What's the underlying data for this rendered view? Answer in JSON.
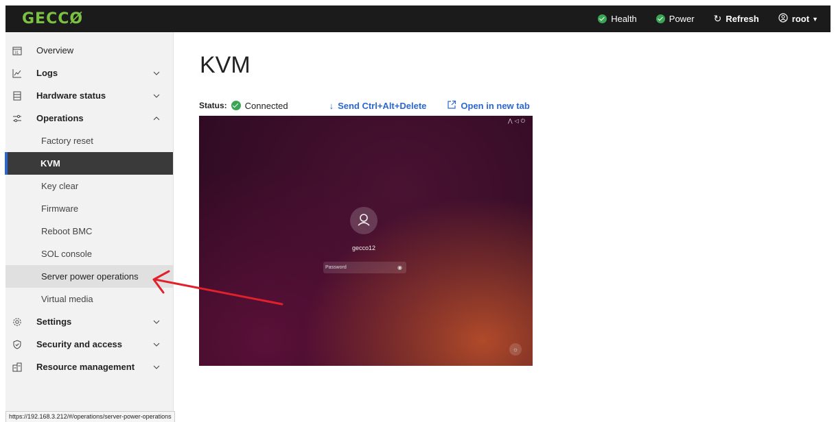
{
  "brand": {
    "logo_text": "GECCØ",
    "accent": "#7cc242"
  },
  "topbar": {
    "health_label": "Health",
    "power_label": "Power",
    "refresh_label": "Refresh",
    "user_label": "root",
    "status_color": "#3aa655"
  },
  "sidebar": {
    "overview": "Overview",
    "logs": "Logs",
    "hardware_status": "Hardware status",
    "operations": "Operations",
    "sub": {
      "factory_reset": "Factory reset",
      "kvm": "KVM",
      "key_clear": "Key clear",
      "firmware": "Firmware",
      "reboot_bmc": "Reboot BMC",
      "sol_console": "SOL console",
      "server_power_operations": "Server power operations",
      "virtual_media": "Virtual media"
    },
    "settings": "Settings",
    "security_and_access": "Security and access",
    "resource_management": "Resource management"
  },
  "main": {
    "title": "KVM",
    "status_label": "Status:",
    "status_value": "Connected",
    "send_cad_label": "Send Ctrl+Alt+Delete",
    "open_new_tab_label": "Open in new tab"
  },
  "kvm_screen": {
    "username": "gecco12",
    "password_placeholder": "Password"
  },
  "status_url": "https://192.168.3.212/#/operations/server-power-operations",
  "annotation_color": "#e0202a"
}
